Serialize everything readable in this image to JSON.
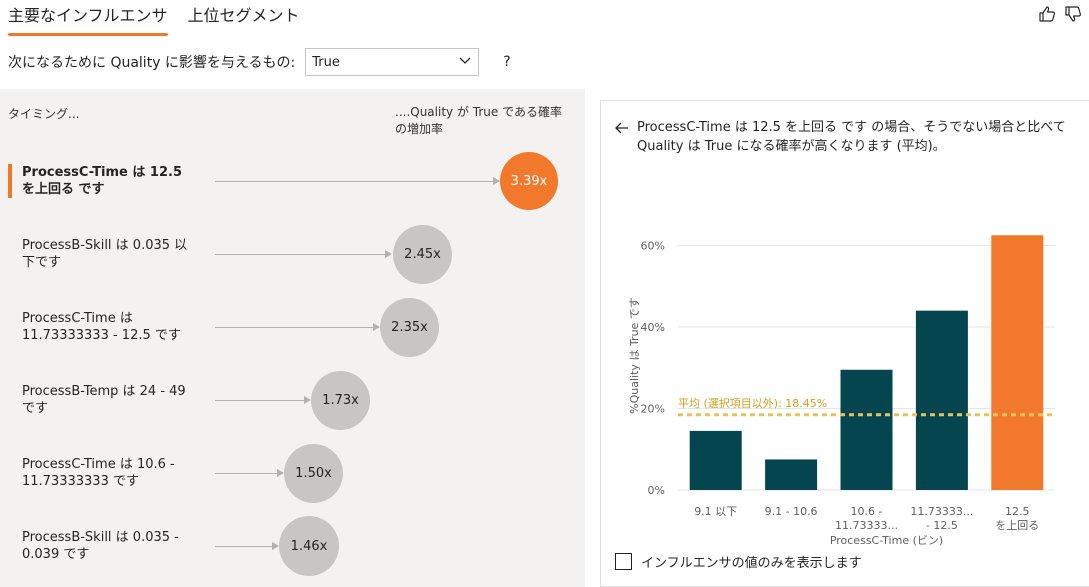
{
  "tabs": [
    {
      "label": "主要なインフルエンサ",
      "active": true
    },
    {
      "label": "上位セグメント",
      "active": false
    }
  ],
  "header": {
    "thumbs_up_icon": "thumbs-up-icon",
    "thumbs_down_icon": "thumbs-down-icon"
  },
  "prompt": {
    "label": "次になるために Quality に影響を与えるもの:",
    "selected": "True",
    "help": "?"
  },
  "influencers": {
    "col_left": "タイミング...",
    "col_right": "....Quality が True である確率の増加率",
    "rows": [
      {
        "label": "ProcessC-Time は 12.5 を上回る です",
        "value": "3.39x",
        "selected": true
      },
      {
        "label": "ProcessB-Skill は 0.035 以下です",
        "value": "2.45x",
        "selected": false
      },
      {
        "label": "ProcessC-Time は 11.73333333 - 12.5 です",
        "value": "2.35x",
        "selected": false
      },
      {
        "label": "ProcessB-Temp は 24 - 49 です",
        "value": "1.73x",
        "selected": false
      },
      {
        "label": "ProcessC-Time は 10.6 - 11.73333333 です",
        "value": "1.50x",
        "selected": false
      },
      {
        "label": "ProcessB-Skill は 0.035 - 0.039 です",
        "value": "1.46x",
        "selected": false
      }
    ]
  },
  "detail": {
    "title": "ProcessC-Time は 12.5 を上回る です の場合、そうでない場合と比べて Quality は True になる確率が高くなります (平均)。",
    "checkbox_label": "インフルエンサの値のみを表示します"
  },
  "colors": {
    "accent": "#f2792b",
    "bar": "#054550",
    "avg": "#e8c35a",
    "bubble": "#c8c6c4"
  },
  "chart_data": {
    "type": "bar",
    "categories": [
      "9.1 以下",
      "9.1 - 10.6",
      "10.6 - 11.73333...",
      "11.73333... - 12.5",
      "12.5 を上回る"
    ],
    "category_lines": [
      [
        "9.1 以下"
      ],
      [
        "9.1 - 10.6"
      ],
      [
        "10.6 -",
        "11.73333..."
      ],
      [
        "11.73333...",
        "- 12.5"
      ],
      [
        "12.5",
        "を上回る"
      ]
    ],
    "values": [
      14.5,
      7.5,
      29.5,
      44,
      62.5
    ],
    "highlight_index": 4,
    "average": 18.45,
    "average_label": "平均 (選択項目以外): 18.45%",
    "xlabel": "ProcessC-Time (ビン)",
    "ylabel": "%Quality は True です",
    "yticks": [
      "0%",
      "20%",
      "40%",
      "60%"
    ],
    "ytick_values": [
      0,
      20,
      40,
      60
    ],
    "ylim": [
      0,
      66
    ],
    "grid": true
  }
}
